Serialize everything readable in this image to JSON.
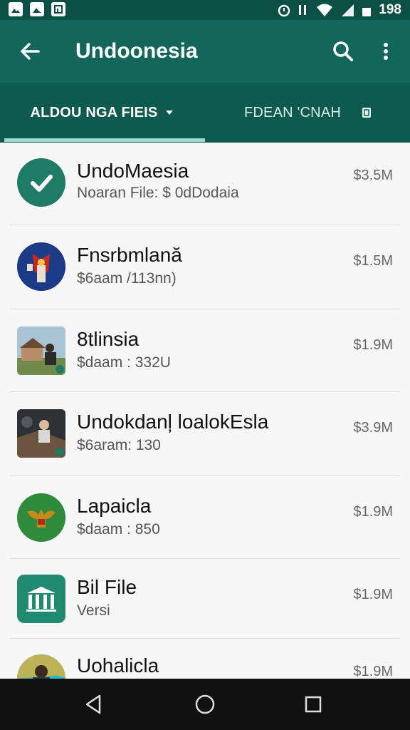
{
  "status_bar": {
    "time": "198",
    "left_icons": [
      "image-icon",
      "photo-icon",
      "gallery-icon"
    ],
    "right_icons": [
      "alarm-icon",
      "nfc-icon",
      "wifi-icon",
      "signal-icon",
      "battery-icon"
    ]
  },
  "app_bar": {
    "title": "Undoonesia",
    "background": "#12665a"
  },
  "tabs": [
    {
      "label": "ALDOU NGA FIEIS",
      "selected": true
    },
    {
      "label": "FDEAN 'CNAH",
      "selected": false
    }
  ],
  "files": [
    {
      "title": "UndoMaesia",
      "subtitle": "Noaran File: $ 0dDodaia",
      "size": "$3.5M",
      "icon": "check-circle-icon"
    },
    {
      "title": "Fnsrbmlană",
      "subtitle": "$6aam /113nn)",
      "size": "$1.5M",
      "icon": "emblem-thumbnail-icon"
    },
    {
      "title": "8tlinsia",
      "subtitle": "$daam : 332U",
      "size": "$1.9M",
      "icon": "photo-house-thumbnail"
    },
    {
      "title": "Undokdanļ loalokEsla",
      "subtitle": "$6aram: 130",
      "size": "$3.9M",
      "icon": "photo-people-thumbnail"
    },
    {
      "title": "Lapaicla",
      "subtitle": "$daam : 850",
      "size": "$1.9M",
      "icon": "garuda-emblem-icon"
    },
    {
      "title": "Bil File",
      "subtitle": "Versi",
      "size": "$1.9M",
      "icon": "building-icon"
    },
    {
      "title": "Uohalicla",
      "subtitle": "",
      "size": "$1.9M",
      "icon": "person-avatar-icon"
    }
  ],
  "colors": {
    "status_bar": "#0b4f45",
    "tab_bar": "#0e5a4f",
    "accent": "#9fd8cf",
    "nav_bar": "#111111"
  }
}
